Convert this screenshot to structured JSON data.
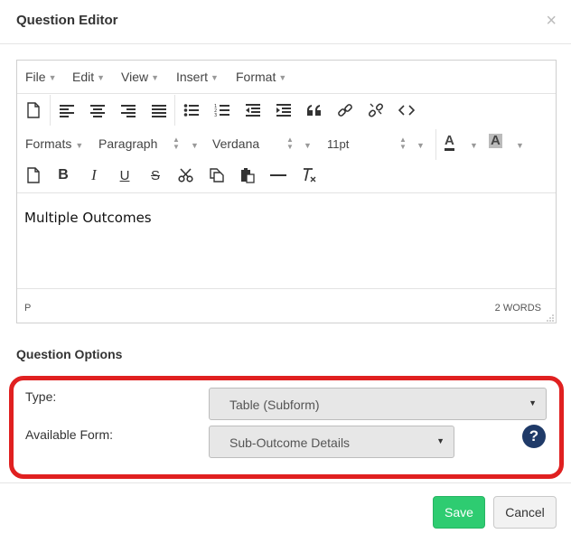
{
  "dialog": {
    "title": "Question Editor",
    "close_glyph": "×"
  },
  "editor": {
    "menu": [
      "File",
      "Edit",
      "View",
      "Insert",
      "Format"
    ],
    "formats_dd": "Formats",
    "block_dd": "Paragraph",
    "font_dd": "Verdana",
    "size_dd": "11pt",
    "content_text": "Multiple Outcomes",
    "status_path": "P",
    "word_count": "2 WORDS",
    "text_color_glyph": "A",
    "bg_color_glyph": "A",
    "icons_row1": [
      "new-document-icon",
      "align-left-icon",
      "align-center-icon",
      "align-right-icon",
      "align-justify-icon",
      "bullet-list-icon",
      "numbered-list-icon",
      "outdent-icon",
      "indent-icon",
      "blockquote-icon",
      "link-icon",
      "unlink-icon",
      "code-icon"
    ],
    "icons_row3": [
      "new-document-icon",
      "bold-icon",
      "italic-icon",
      "underline-icon",
      "strikethrough-icon",
      "cut-icon",
      "copy-icon",
      "paste-icon",
      "horizontal-rule-icon",
      "clear-formatting-icon"
    ]
  },
  "options": {
    "section_title": "Question Options",
    "type_label": "Type:",
    "type_value": "Table (Subform)",
    "form_label": "Available Form:",
    "form_value": "Sub-Outcome Details",
    "help_glyph": "?"
  },
  "footer": {
    "save_label": "Save",
    "cancel_label": "Cancel"
  },
  "colors": {
    "save": "#2ecc71",
    "highlight": "#e02020",
    "help": "#1f3a68"
  }
}
